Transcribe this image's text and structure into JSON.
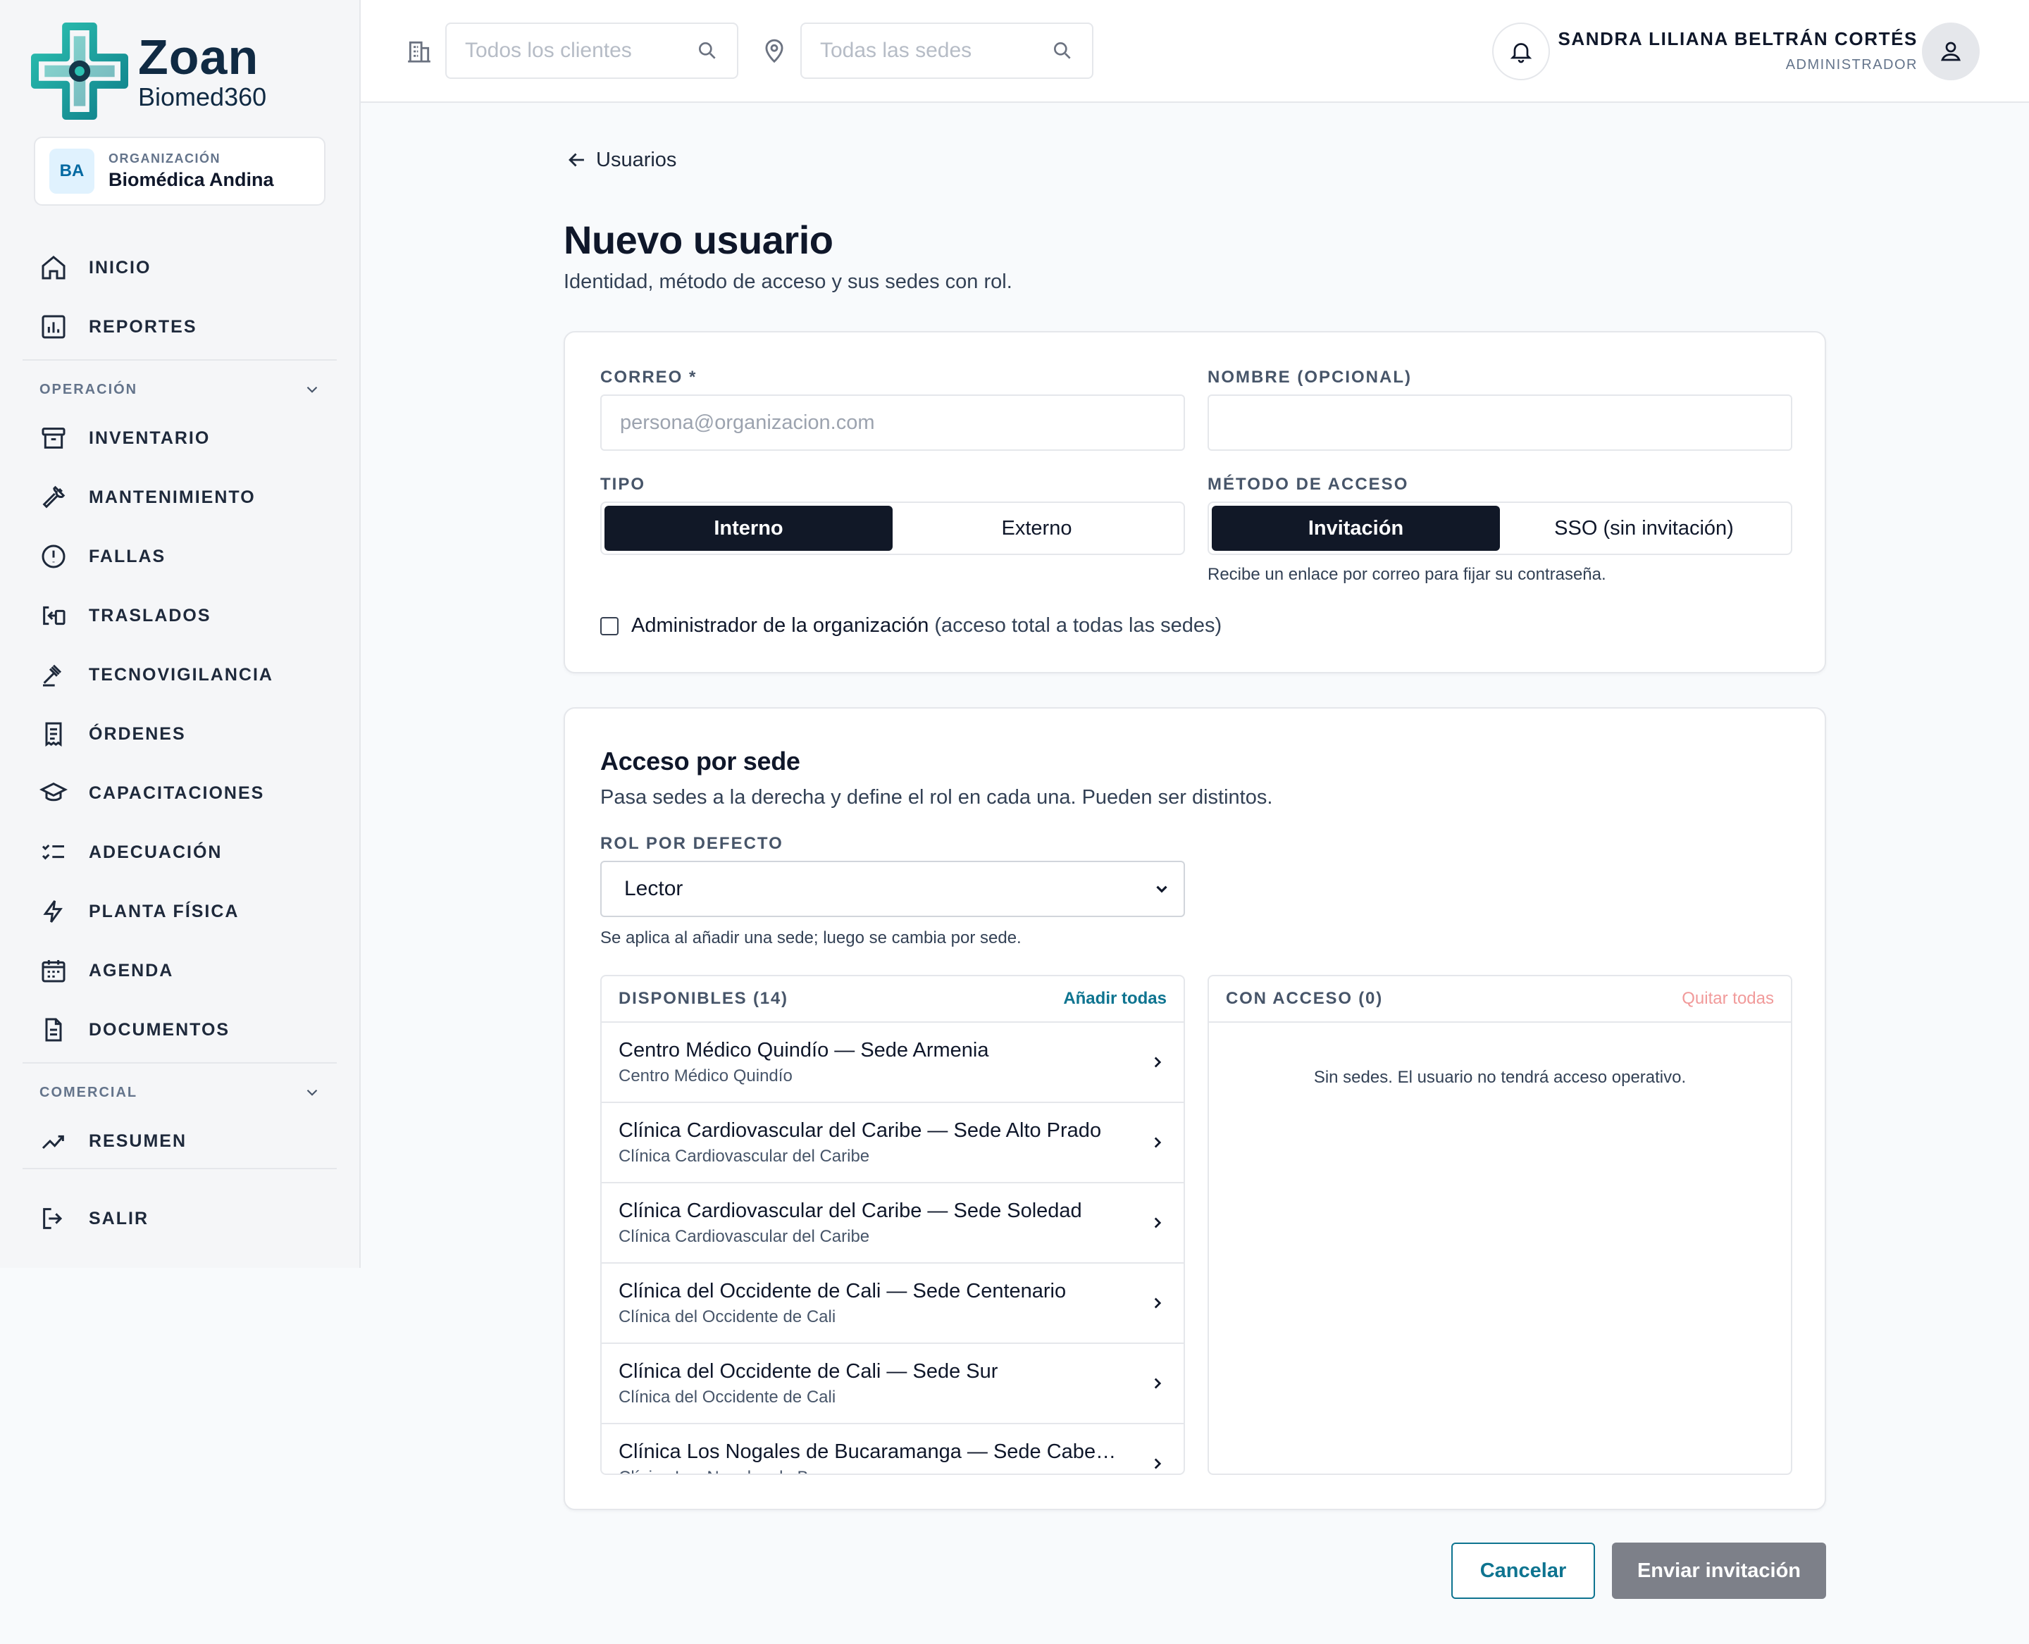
{
  "brand": {
    "title": "Zoan",
    "subtitle": "Biomed360"
  },
  "organization": {
    "badge": "BA",
    "label": "ORGANIZACIÓN",
    "name": "Biomédica Andina"
  },
  "sidebar": {
    "top_items": [
      {
        "label": "INICIO",
        "icon": "home-icon"
      },
      {
        "label": "REPORTES",
        "icon": "reports-icon"
      }
    ],
    "sections": [
      {
        "label": "OPERACIÓN",
        "items": [
          {
            "label": "INVENTARIO",
            "icon": "archive-icon"
          },
          {
            "label": "MANTENIMIENTO",
            "icon": "wrench-icon"
          },
          {
            "label": "FALLAS",
            "icon": "alert-icon"
          },
          {
            "label": "TRASLADOS",
            "icon": "transfer-icon"
          },
          {
            "label": "TECNOVIGILANCIA",
            "icon": "gavel-icon"
          },
          {
            "label": "ÓRDENES",
            "icon": "receipt-icon"
          },
          {
            "label": "CAPACITACIONES",
            "icon": "graduation-icon"
          },
          {
            "label": "ADECUACIÓN",
            "icon": "checklist-icon"
          },
          {
            "label": "PLANTA FÍSICA",
            "icon": "bolt-icon"
          },
          {
            "label": "AGENDA",
            "icon": "calendar-icon"
          },
          {
            "label": "DOCUMENTOS",
            "icon": "document-icon"
          }
        ]
      },
      {
        "label": "COMERCIAL",
        "items": [
          {
            "label": "RESUMEN",
            "icon": "trend-icon"
          }
        ]
      }
    ],
    "logout": {
      "label": "SALIR",
      "icon": "logout-icon"
    }
  },
  "topbar": {
    "clients_placeholder": "Todos los clientes",
    "sites_placeholder": "Todas las sedes",
    "user_name": "SANDRA LILIANA BELTRÁN CORTÉS",
    "user_role": "ADMINISTRADOR"
  },
  "page": {
    "back_label": "Usuarios",
    "title": "Nuevo usuario",
    "subtitle": "Identidad, método de acceso y sus sedes con rol."
  },
  "identity": {
    "email_label": "CORREO *",
    "email_placeholder": "persona@organizacion.com",
    "email_value": "",
    "name_label": "NOMBRE (OPCIONAL)",
    "name_value": "",
    "type_label": "TIPO",
    "type_options": [
      "Interno",
      "Externo"
    ],
    "type_selected": "Interno",
    "access_label": "MÉTODO DE ACCESO",
    "access_options": [
      "Invitación",
      "SSO (sin invitación)"
    ],
    "access_selected": "Invitación",
    "access_hint": "Recibe un enlace por correo para fijar su contraseña.",
    "admin_label": "Administrador de la organización",
    "admin_note": "(acceso total a todas las sedes)",
    "admin_checked": false
  },
  "sites": {
    "title": "Acceso por sede",
    "subtitle": "Pasa sedes a la derecha y define el rol en cada una. Pueden ser distintos.",
    "default_role_label": "ROL POR DEFECTO",
    "default_role": "Lector",
    "default_role_hint": "Se aplica al añadir una sede; luego se cambia por sede.",
    "available_label": "DISPONIBLES (14)",
    "add_all": "Añadir todas",
    "with_access_label": "CON ACCESO (0)",
    "remove_all": "Quitar todas",
    "empty_message": "Sin sedes. El usuario no tendrá acceso operativo.",
    "available": [
      {
        "title": "Centro Médico Quindío — Sede Armenia",
        "org": "Centro Médico Quindío"
      },
      {
        "title": "Clínica Cardiovascular del Caribe — Sede Alto Prado",
        "org": "Clínica Cardiovascular del Caribe"
      },
      {
        "title": "Clínica Cardiovascular del Caribe — Sede Soledad",
        "org": "Clínica Cardiovascular del Caribe"
      },
      {
        "title": "Clínica del Occidente de Cali — Sede Centenario",
        "org": "Clínica del Occidente de Cali"
      },
      {
        "title": "Clínica del Occidente de Cali — Sede Sur",
        "org": "Clínica del Occidente de Cali"
      },
      {
        "title": "Clínica Los Nogales de Bucaramanga — Sede Cabecera",
        "org": "Clínica Los Nogales de Bucaramanga"
      }
    ]
  },
  "actions": {
    "cancel": "Cancelar",
    "submit": "Enviar invitación"
  },
  "colors": {
    "accent": "#0e7490",
    "danger_muted": "#f19a9a",
    "dark": "#111827",
    "brand_teal": "#14a39a"
  }
}
